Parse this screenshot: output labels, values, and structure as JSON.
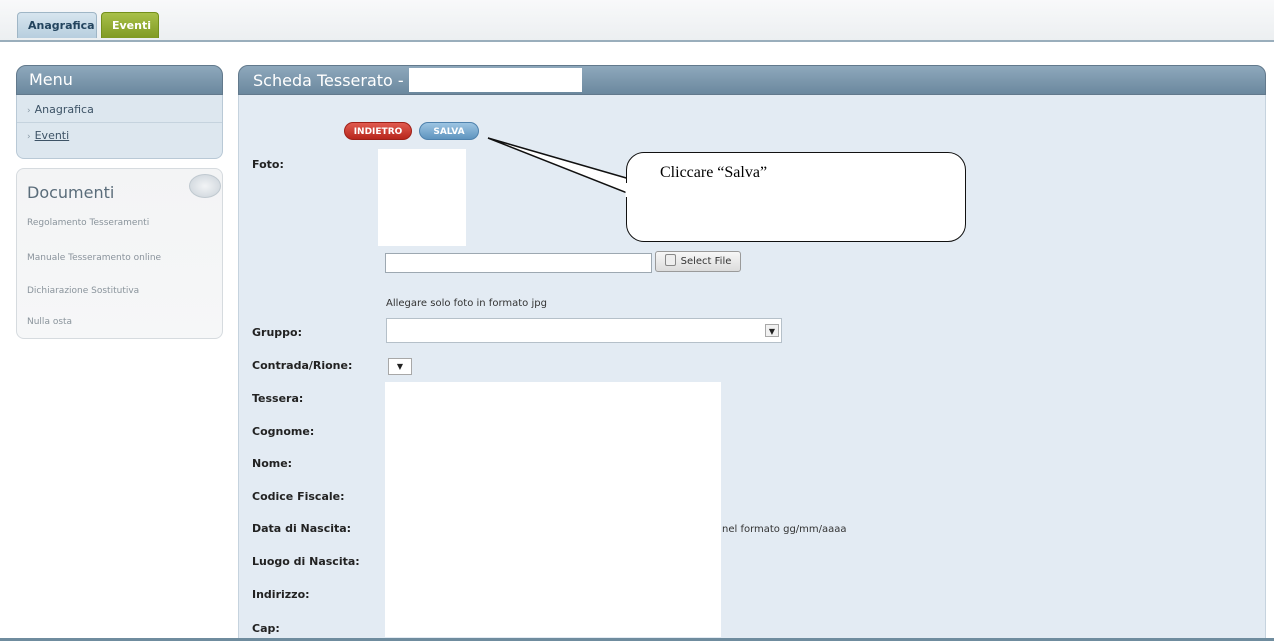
{
  "top_tabs": [
    {
      "label": "Anagrafica"
    },
    {
      "label": "Eventi"
    }
  ],
  "sidebar": {
    "menu_title": "Menu",
    "menu_items": [
      {
        "label": "Anagrafica"
      },
      {
        "label": "Eventi"
      }
    ],
    "documents_title": "Documenti",
    "documents": [
      {
        "label": "Regolamento Tesseramenti"
      },
      {
        "label": "Manuale Tesseramento online"
      },
      {
        "label": "Dichiarazione Sostitutiva"
      },
      {
        "label": "Nulla osta"
      }
    ]
  },
  "main": {
    "title": "Scheda Tesserato -",
    "buttons": {
      "back": "INDIETRO",
      "save": "SALVA"
    },
    "file_button": "Select File",
    "photo_hint": "Allegare solo foto in formato jpg",
    "date_hint": "nel formato gg/mm/aaaa",
    "labels": {
      "foto": "Foto:",
      "gruppo": "Gruppo:",
      "contrada": "Contrada/Rione:",
      "tessera": "Tessera:",
      "cognome": "Cognome:",
      "nome": "Nome:",
      "codice_fiscale": "Codice Fiscale:",
      "data_nascita": "Data di Nascita:",
      "luogo_nascita": "Luogo di Nascita:",
      "indirizzo": "Indirizzo:",
      "cap": "Cap:"
    }
  },
  "callout": {
    "text": "Cliccare “Salva”"
  },
  "icons": {
    "dropdown": "▼"
  }
}
